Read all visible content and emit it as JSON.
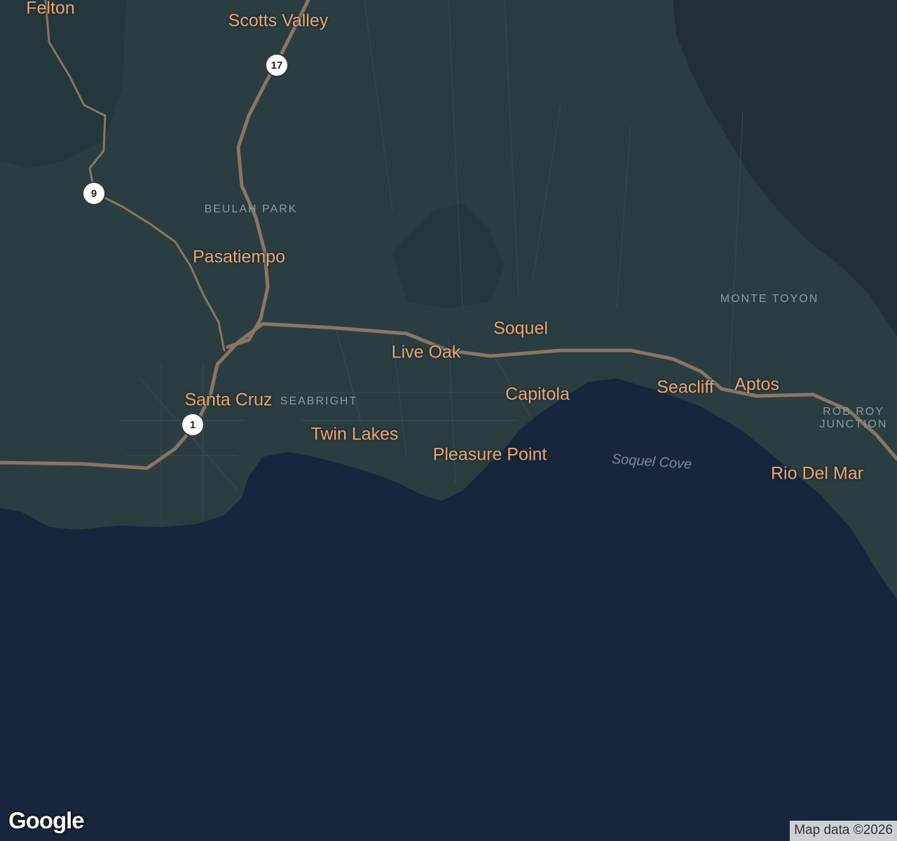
{
  "map": {
    "colors": {
      "land": "#2a3d41",
      "land_dark": "#1f2e33",
      "water": "#17263c",
      "highway": "#8a7564",
      "city_label": "#e9a472",
      "neighborhood_label": "#8f9a9e"
    },
    "cities": {
      "felton": "Felton",
      "scotts_valley": "Scotts Valley",
      "pasatiempo": "Pasatiempo",
      "soquel": "Soquel",
      "live_oak": "Live Oak",
      "santa_cruz": "Santa Cruz",
      "capitola": "Capitola",
      "seacliff": "Seacliff",
      "aptos": "Aptos",
      "twin_lakes": "Twin Lakes",
      "pleasure_point": "Pleasure Point",
      "rio_del_mar": "Rio Del Mar"
    },
    "neighborhoods": {
      "beulah_park": "BEULAH PARK",
      "monte_toyon": "MONTE TOYON",
      "seabright": "SEABRIGHT",
      "rob_roy_junction": "ROB ROY JUNCTION"
    },
    "water_labels": {
      "soquel_cove": "Soquel Cove"
    },
    "route_shields": {
      "route_17": "17",
      "route_9": "9",
      "route_1": "1"
    }
  },
  "branding": {
    "logo": "Google",
    "attribution": "Map data ©2026"
  }
}
